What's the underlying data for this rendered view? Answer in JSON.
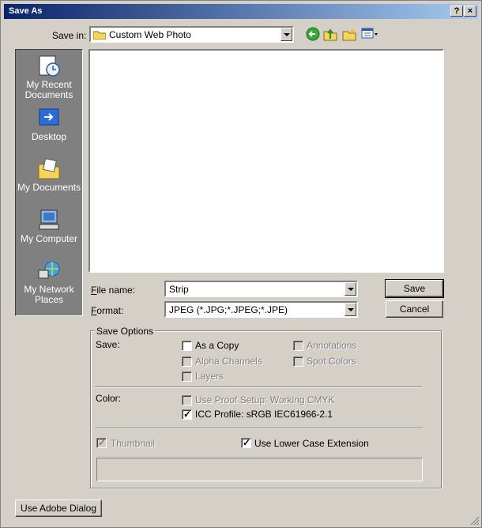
{
  "window": {
    "title": "Save As",
    "help_button": "?",
    "close_button": "×"
  },
  "save_in": {
    "label": "Save in:",
    "value": "Custom Web Photo"
  },
  "places": [
    {
      "label": "My Recent Documents",
      "icon": "recent-documents-icon"
    },
    {
      "label": "Desktop",
      "icon": "desktop-icon"
    },
    {
      "label": "My Documents",
      "icon": "my-documents-icon"
    },
    {
      "label": "My Computer",
      "icon": "my-computer-icon"
    },
    {
      "label": "My Network Places",
      "icon": "network-places-icon"
    }
  ],
  "file_name": {
    "label": "File name:",
    "value": "Strip"
  },
  "format": {
    "label": "Format:",
    "value": "JPEG (*.JPG;*.JPEG;*.JPE)"
  },
  "buttons": {
    "save": "Save",
    "cancel": "Cancel",
    "use_adobe_dialog": "Use Adobe Dialog"
  },
  "save_options": {
    "title": "Save Options",
    "save_label": "Save:",
    "as_a_copy": {
      "label": "As a Copy",
      "checked": false,
      "enabled": true
    },
    "annotations": {
      "label": "Annotations",
      "checked": false,
      "enabled": false
    },
    "alpha_channels": {
      "label": "Alpha Channels",
      "checked": false,
      "enabled": false
    },
    "spot_colors": {
      "label": "Spot Colors",
      "checked": false,
      "enabled": false
    },
    "layers": {
      "label": "Layers",
      "checked": false,
      "enabled": false
    },
    "color_label": "Color:",
    "use_proof_setup": {
      "label": "Use Proof Setup:  Working CMYK",
      "checked": false,
      "enabled": false
    },
    "icc_profile": {
      "label": "ICC Profile:  sRGB IEC61966-2.1",
      "checked": true,
      "enabled": true
    },
    "thumbnail": {
      "label": "Thumbnail",
      "checked": true,
      "enabled": false
    },
    "lower_case_ext": {
      "label": "Use Lower Case Extension",
      "checked": true,
      "enabled": true
    }
  }
}
